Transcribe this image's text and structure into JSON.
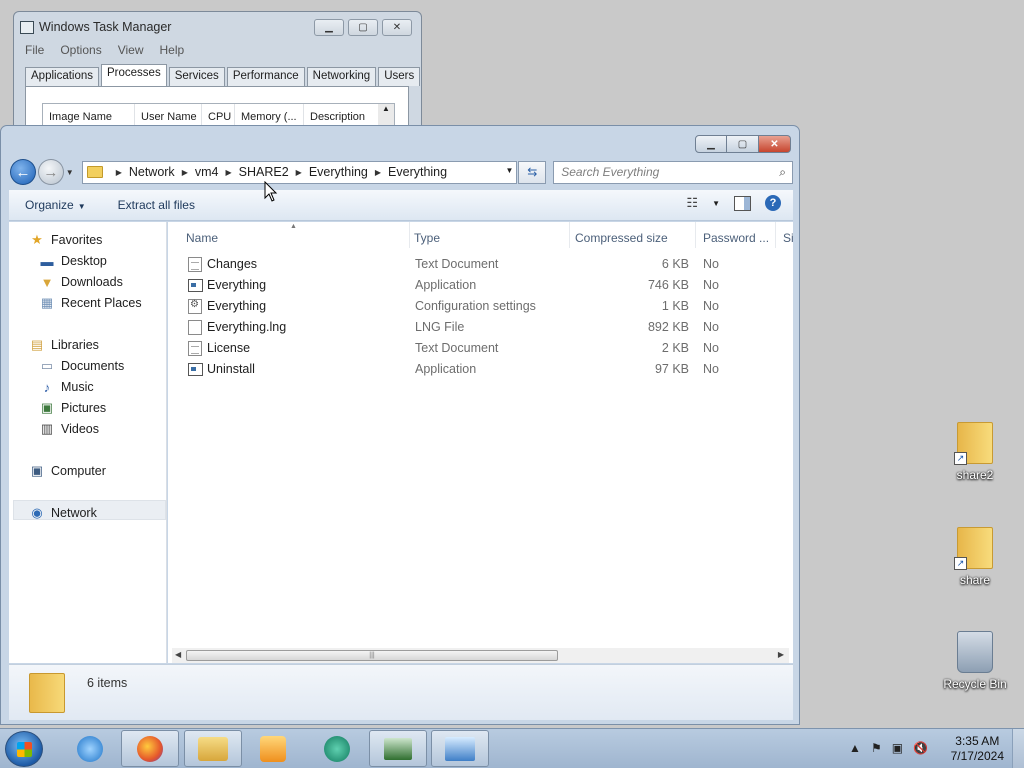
{
  "task_manager": {
    "title": "Windows Task Manager",
    "menu": [
      "File",
      "Options",
      "View",
      "Help"
    ],
    "tabs": [
      "Applications",
      "Processes",
      "Services",
      "Performance",
      "Networking",
      "Users"
    ],
    "active_tab": "Processes",
    "columns": [
      "Image Name",
      "User Name",
      "CPU",
      "Memory (...",
      "Description"
    ]
  },
  "explorer": {
    "breadcrumb": [
      "Network",
      "vm4",
      "SHARE2",
      "Everything",
      "Everything"
    ],
    "search_placeholder": "Search Everything",
    "commands": {
      "organize": "Organize",
      "extract": "Extract all files"
    },
    "nav": {
      "favorites": "Favorites",
      "desktop": "Desktop",
      "downloads": "Downloads",
      "recent": "Recent Places",
      "libraries": "Libraries",
      "documents": "Documents",
      "music": "Music",
      "pictures": "Pictures",
      "videos": "Videos",
      "computer": "Computer",
      "network": "Network"
    },
    "columns": {
      "name": "Name",
      "type": "Type",
      "size": "Compressed size",
      "password": "Password ...",
      "extra": "Si"
    },
    "files": [
      {
        "name": "Changes",
        "type": "Text Document",
        "size": "6 KB",
        "password": "No",
        "icon": "text-file-icon"
      },
      {
        "name": "Everything",
        "type": "Application",
        "size": "746 KB",
        "password": "No",
        "icon": "application-icon"
      },
      {
        "name": "Everything",
        "type": "Configuration settings",
        "size": "1 KB",
        "password": "No",
        "icon": "config-file-icon"
      },
      {
        "name": "Everything.lng",
        "type": "LNG File",
        "size": "892 KB",
        "password": "No",
        "icon": "blank-file-icon"
      },
      {
        "name": "License",
        "type": "Text Document",
        "size": "2 KB",
        "password": "No",
        "icon": "text-file-icon"
      },
      {
        "name": "Uninstall",
        "type": "Application",
        "size": "97 KB",
        "password": "No",
        "icon": "application-icon"
      }
    ],
    "status_count": "6 items"
  },
  "desktop_icons": {
    "share2": "share2",
    "share": "share",
    "recycle": "Recycle Bin"
  },
  "taskbar": {
    "time": "3:35 AM",
    "date": "7/17/2024"
  }
}
